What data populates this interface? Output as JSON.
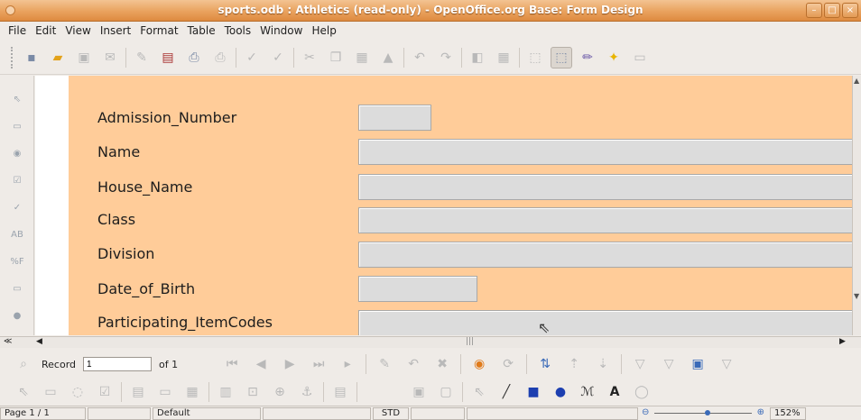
{
  "window": {
    "title": "sports.odb : Athletics (read-only) - OpenOffice.org Base: Form Design",
    "buttons": {
      "minimize": "–",
      "maximize": "□",
      "close": "×"
    }
  },
  "menu": [
    "File",
    "Edit",
    "View",
    "Insert",
    "Format",
    "Table",
    "Tools",
    "Window",
    "Help"
  ],
  "toolbar": {
    "icons": [
      "new-icon",
      "open-icon",
      "save-icon",
      "email-icon",
      "edit-icon",
      "pdf-icon",
      "print-icon",
      "print-preview-icon",
      "spellcheck-icon",
      "autospell-icon",
      "cut-icon",
      "copy-icon",
      "paste-icon",
      "format-paintbrush-icon",
      "undo-icon",
      "redo-icon",
      "navigator-icon",
      "table-icon",
      "control-wizard-icon",
      "design-mode-icon",
      "gallery-icon",
      "star-icon",
      "data-sources-icon"
    ]
  },
  "form": {
    "fields": [
      {
        "label": "Admission_Number",
        "short": true
      },
      {
        "label": "Name",
        "short": false
      },
      {
        "label": "House_Name",
        "short": false
      },
      {
        "label": "Class",
        "short": false
      },
      {
        "label": "Division",
        "short": false
      },
      {
        "label": "Date_of_Birth",
        "short": true
      },
      {
        "label": "Participating_ItemCodes",
        "short": false
      }
    ],
    "background": "#ffcc99"
  },
  "navigation": {
    "record_label": "Record",
    "record_value": "1",
    "of_label": "of 1"
  },
  "statusbar": {
    "page": "Page 1 / 1",
    "style": "Default",
    "mode": "STD",
    "zoom": "152%"
  },
  "colors": {
    "titlebar": "#e39a55",
    "form_background": "#ffcc99",
    "field_fill": "#dcdcdc"
  }
}
